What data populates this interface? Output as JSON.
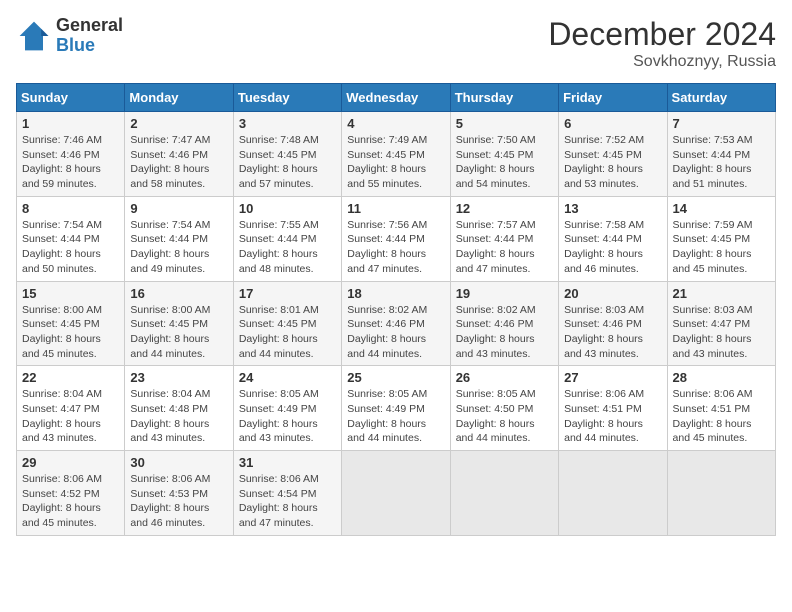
{
  "header": {
    "logo_general": "General",
    "logo_blue": "Blue",
    "month_title": "December 2024",
    "location": "Sovkhoznyy, Russia"
  },
  "days_of_week": [
    "Sunday",
    "Monday",
    "Tuesday",
    "Wednesday",
    "Thursday",
    "Friday",
    "Saturday"
  ],
  "weeks": [
    [
      {
        "day": 1,
        "info": "Sunrise: 7:46 AM\nSunset: 4:46 PM\nDaylight: 8 hours\nand 59 minutes."
      },
      {
        "day": 2,
        "info": "Sunrise: 7:47 AM\nSunset: 4:46 PM\nDaylight: 8 hours\nand 58 minutes."
      },
      {
        "day": 3,
        "info": "Sunrise: 7:48 AM\nSunset: 4:45 PM\nDaylight: 8 hours\nand 57 minutes."
      },
      {
        "day": 4,
        "info": "Sunrise: 7:49 AM\nSunset: 4:45 PM\nDaylight: 8 hours\nand 55 minutes."
      },
      {
        "day": 5,
        "info": "Sunrise: 7:50 AM\nSunset: 4:45 PM\nDaylight: 8 hours\nand 54 minutes."
      },
      {
        "day": 6,
        "info": "Sunrise: 7:52 AM\nSunset: 4:45 PM\nDaylight: 8 hours\nand 53 minutes."
      },
      {
        "day": 7,
        "info": "Sunrise: 7:53 AM\nSunset: 4:44 PM\nDaylight: 8 hours\nand 51 minutes."
      }
    ],
    [
      {
        "day": 8,
        "info": "Sunrise: 7:54 AM\nSunset: 4:44 PM\nDaylight: 8 hours\nand 50 minutes."
      },
      {
        "day": 9,
        "info": "Sunrise: 7:54 AM\nSunset: 4:44 PM\nDaylight: 8 hours\nand 49 minutes."
      },
      {
        "day": 10,
        "info": "Sunrise: 7:55 AM\nSunset: 4:44 PM\nDaylight: 8 hours\nand 48 minutes."
      },
      {
        "day": 11,
        "info": "Sunrise: 7:56 AM\nSunset: 4:44 PM\nDaylight: 8 hours\nand 47 minutes."
      },
      {
        "day": 12,
        "info": "Sunrise: 7:57 AM\nSunset: 4:44 PM\nDaylight: 8 hours\nand 47 minutes."
      },
      {
        "day": 13,
        "info": "Sunrise: 7:58 AM\nSunset: 4:44 PM\nDaylight: 8 hours\nand 46 minutes."
      },
      {
        "day": 14,
        "info": "Sunrise: 7:59 AM\nSunset: 4:45 PM\nDaylight: 8 hours\nand 45 minutes."
      }
    ],
    [
      {
        "day": 15,
        "info": "Sunrise: 8:00 AM\nSunset: 4:45 PM\nDaylight: 8 hours\nand 45 minutes."
      },
      {
        "day": 16,
        "info": "Sunrise: 8:00 AM\nSunset: 4:45 PM\nDaylight: 8 hours\nand 44 minutes."
      },
      {
        "day": 17,
        "info": "Sunrise: 8:01 AM\nSunset: 4:45 PM\nDaylight: 8 hours\nand 44 minutes."
      },
      {
        "day": 18,
        "info": "Sunrise: 8:02 AM\nSunset: 4:46 PM\nDaylight: 8 hours\nand 44 minutes."
      },
      {
        "day": 19,
        "info": "Sunrise: 8:02 AM\nSunset: 4:46 PM\nDaylight: 8 hours\nand 43 minutes."
      },
      {
        "day": 20,
        "info": "Sunrise: 8:03 AM\nSunset: 4:46 PM\nDaylight: 8 hours\nand 43 minutes."
      },
      {
        "day": 21,
        "info": "Sunrise: 8:03 AM\nSunset: 4:47 PM\nDaylight: 8 hours\nand 43 minutes."
      }
    ],
    [
      {
        "day": 22,
        "info": "Sunrise: 8:04 AM\nSunset: 4:47 PM\nDaylight: 8 hours\nand 43 minutes."
      },
      {
        "day": 23,
        "info": "Sunrise: 8:04 AM\nSunset: 4:48 PM\nDaylight: 8 hours\nand 43 minutes."
      },
      {
        "day": 24,
        "info": "Sunrise: 8:05 AM\nSunset: 4:49 PM\nDaylight: 8 hours\nand 43 minutes."
      },
      {
        "day": 25,
        "info": "Sunrise: 8:05 AM\nSunset: 4:49 PM\nDaylight: 8 hours\nand 44 minutes."
      },
      {
        "day": 26,
        "info": "Sunrise: 8:05 AM\nSunset: 4:50 PM\nDaylight: 8 hours\nand 44 minutes."
      },
      {
        "day": 27,
        "info": "Sunrise: 8:06 AM\nSunset: 4:51 PM\nDaylight: 8 hours\nand 44 minutes."
      },
      {
        "day": 28,
        "info": "Sunrise: 8:06 AM\nSunset: 4:51 PM\nDaylight: 8 hours\nand 45 minutes."
      }
    ],
    [
      {
        "day": 29,
        "info": "Sunrise: 8:06 AM\nSunset: 4:52 PM\nDaylight: 8 hours\nand 45 minutes."
      },
      {
        "day": 30,
        "info": "Sunrise: 8:06 AM\nSunset: 4:53 PM\nDaylight: 8 hours\nand 46 minutes."
      },
      {
        "day": 31,
        "info": "Sunrise: 8:06 AM\nSunset: 4:54 PM\nDaylight: 8 hours\nand 47 minutes."
      },
      null,
      null,
      null,
      null
    ]
  ]
}
